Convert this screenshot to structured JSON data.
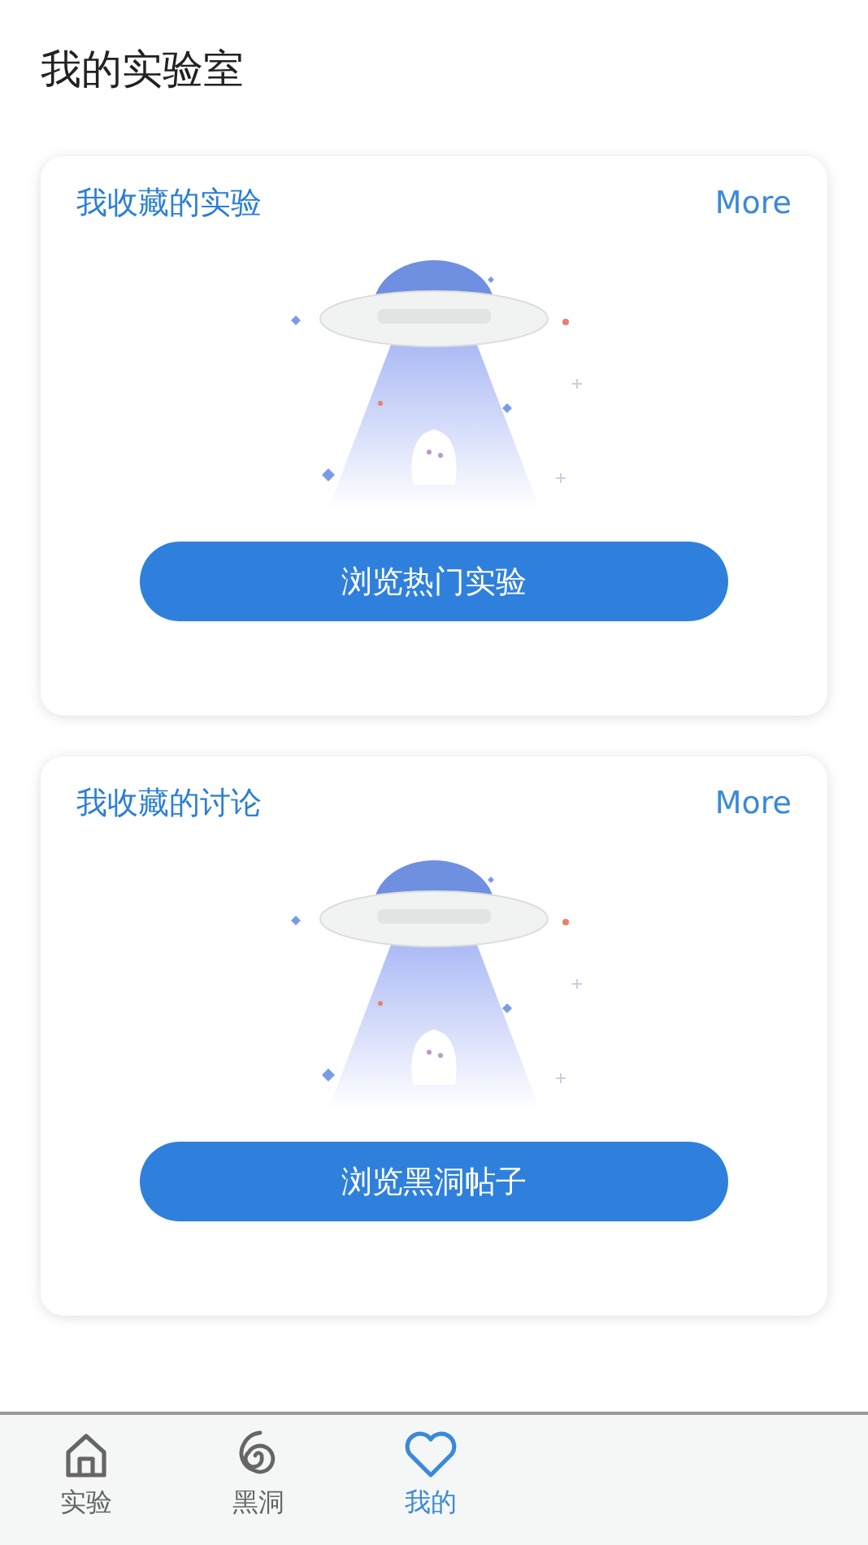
{
  "page_title": "我的实验室",
  "cards": [
    {
      "title": "我收藏的实验",
      "more": "More",
      "button": "浏览热门实验"
    },
    {
      "title": "我收藏的讨论",
      "more": "More",
      "button": "浏览黑洞帖子"
    }
  ],
  "tab_bar": [
    {
      "label": "实验",
      "kind": "home",
      "selected": false
    },
    {
      "label": "黑洞",
      "kind": "spiral",
      "selected": false
    },
    {
      "label": "我的",
      "kind": "heart",
      "selected": true
    }
  ]
}
